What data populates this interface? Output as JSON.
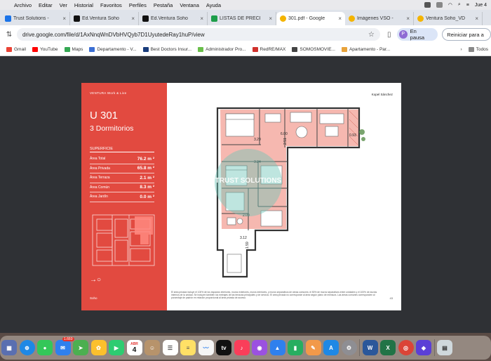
{
  "menubar": {
    "items": [
      "Archivo",
      "Editar",
      "Ver",
      "Historial",
      "Favoritos",
      "Perfiles",
      "Pestaña",
      "Ventana",
      "Ayuda"
    ],
    "clock": "Jue 4"
  },
  "tabs": [
    {
      "title": "Trust Solutions - ",
      "color": "#1a73e8"
    },
    {
      "title": "Ed.Ventura Soho",
      "color": "#111111"
    },
    {
      "title": "Ed.Ventura Soho",
      "color": "#111111"
    },
    {
      "title": "LISTAS DE PRECI",
      "color": "#1e9e4a"
    },
    {
      "title": "301.pdf - Google",
      "color": "#f4b400",
      "active": true
    },
    {
      "title": "Imágenes VSO - ",
      "color": "#f4b400"
    },
    {
      "title": "Ventura Soho_VD",
      "color": "#f4b400"
    }
  ],
  "address": {
    "url": "drive.google.com/file/d/1AxNnqWnDVbHVQyb7D1UyutedeRay1huP/view",
    "profile_initial": "P",
    "profile_label": "En pausa",
    "restart_label": "Reiniciar para a"
  },
  "bookmarks": [
    {
      "label": "Gmail",
      "color": "#ea4335"
    },
    {
      "label": "YouTube",
      "color": "#ff0000"
    },
    {
      "label": "Maps",
      "color": "#34a853"
    },
    {
      "label": "Departamento - V...",
      "color": "#3b6fd4"
    },
    {
      "label": "Best Doctors Insur...",
      "color": "#1a3d7c"
    },
    {
      "label": "Administrador Pro...",
      "color": "#6abf4b"
    },
    {
      "label": "RedRE/MAX",
      "color": "#d0312d"
    },
    {
      "label": "SOMOSMOVIE...",
      "color": "#444444"
    },
    {
      "label": "Apartamento - Par...",
      "color": "#e8a33b"
    }
  ],
  "bookmarks_more": "Todos",
  "pdf": {
    "brand": "VENTURA Work & Live",
    "unit": "U 301",
    "bedrooms": "3 Dormitorios",
    "surface_title": "SUPERFICIE",
    "surfaces": [
      {
        "label": "Área Total",
        "value": "76.2 m ²"
      },
      {
        "label": "Área Privada",
        "value": "65.8 m ²"
      },
      {
        "label": "Área Terraza",
        "value": "2.1 m ²"
      },
      {
        "label": "Área Común",
        "value": "8.3 m ²"
      },
      {
        "label": "Área Jardín",
        "value": "0.0 m ²"
      }
    ],
    "panel_logo": "Soho",
    "plan_brand": "Kopel Sánchez",
    "watermark": "TRUST SOLUTIONS",
    "dims": [
      "3.29",
      "6.00",
      "2.51",
      "0.93",
      "3.24",
      "2.09",
      "3.12",
      "1.59"
    ],
    "footnote": "El área privada incluye el 100% de los espacios interiores, muros exteriores, muros interiores, y muros separativos de áreas comunes; el 50% de muros separativos entre unidades y el 100% de ductos internos de la unidad. Se incluyen también los metrajes de las terrazas principales y de servicio. El área privada no corresponde al área según plano de mensura. Las áreas comunes corresponden al porcentaje de padrón en relación proporcional al área privada de acceso.",
    "page_number": "43"
  },
  "dock": {
    "mail_badge": "1.660",
    "calendar_month": "ABR",
    "calendar_day": "4"
  }
}
